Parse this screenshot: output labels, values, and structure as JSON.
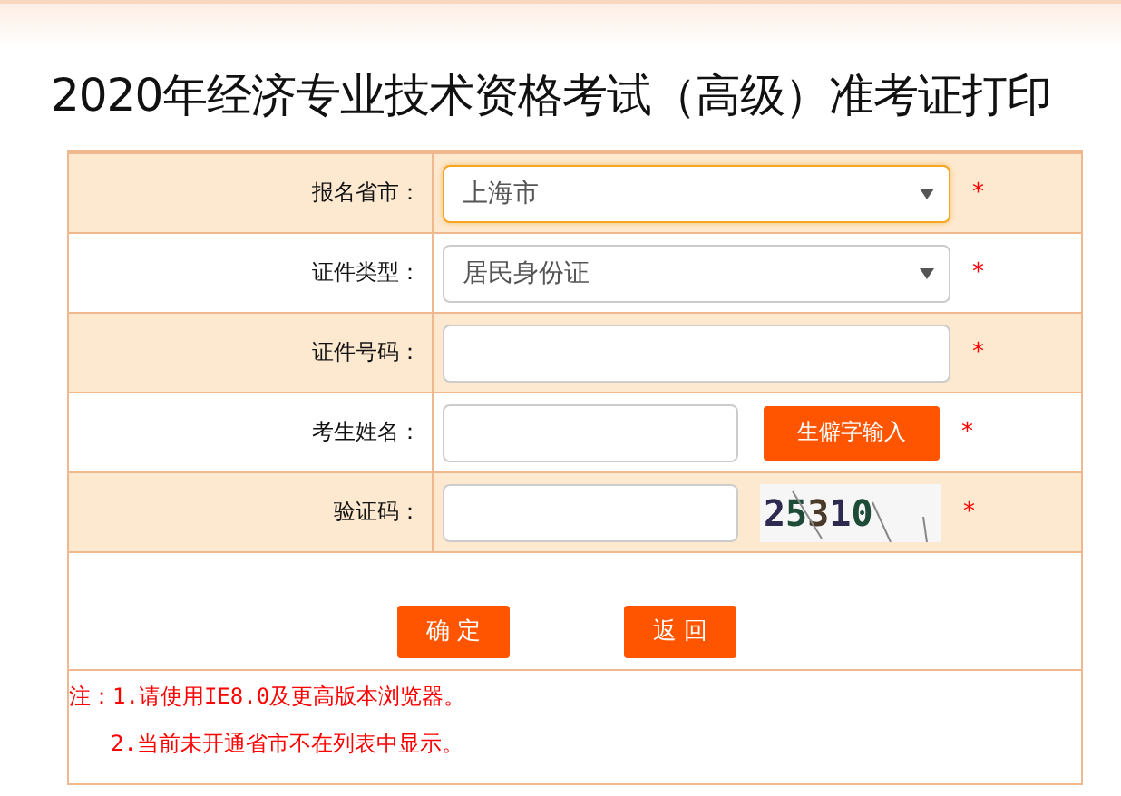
{
  "title": "2020年经济专业技术资格考试（高级）准考证打印",
  "rows": [
    {
      "label": "报名省市：",
      "kind": "select",
      "value": "上海市",
      "focused": true,
      "required": "*"
    },
    {
      "label": "证件类型：",
      "kind": "select",
      "value": "居民身份证",
      "focused": false,
      "required": "*"
    },
    {
      "label": "证件号码：",
      "kind": "input",
      "focused": false,
      "required": "*"
    },
    {
      "label": "考生姓名：",
      "kind": "input",
      "focused": false,
      "extra": {
        "kind": "button",
        "text": "生僻字输入"
      },
      "required": "*"
    },
    {
      "label": "验证码：",
      "kind": "input",
      "focused": false,
      "extra": {
        "kind": "captcha",
        "text": "25310"
      },
      "required": "*"
    }
  ],
  "buttons": [
    "确 定",
    "返 回"
  ],
  "notes": {
    "prefix": "注：",
    "lines": [
      "1.请使用IE8.0及更高版本浏览器。",
      "2.当前未开通省市不在列表中显示。"
    ]
  }
}
